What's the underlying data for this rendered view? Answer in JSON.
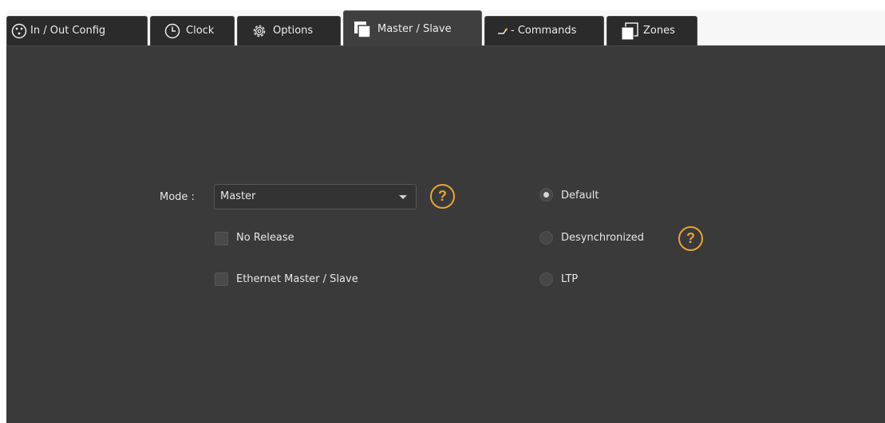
{
  "tabs": [
    {
      "label": "In / Out Config",
      "icon": "connector-icon"
    },
    {
      "label": "Clock",
      "icon": "clock-icon"
    },
    {
      "label": "Options",
      "icon": "gear-icon"
    },
    {
      "label": "Master / Slave",
      "icon": "master-slave-icon",
      "active": true
    },
    {
      "label": "Commands",
      "icon": "commands-icon",
      "prefix": "- "
    },
    {
      "label": "Zones",
      "icon": "zones-icon"
    }
  ],
  "mode": {
    "label": "Mode :",
    "value": "Master"
  },
  "help_glyph": "?",
  "checkboxes": [
    {
      "label": "No Release",
      "checked": false
    },
    {
      "label": "Ethernet Master / Slave",
      "checked": false
    }
  ],
  "radios": [
    {
      "label": "Default",
      "selected": true
    },
    {
      "label": "Desynchronized",
      "selected": false
    },
    {
      "label": "LTP",
      "selected": false
    }
  ],
  "colors": {
    "panel_background": "#3a3a3a",
    "accent_help": "#e8a33a",
    "text": "#e6e6e6"
  }
}
